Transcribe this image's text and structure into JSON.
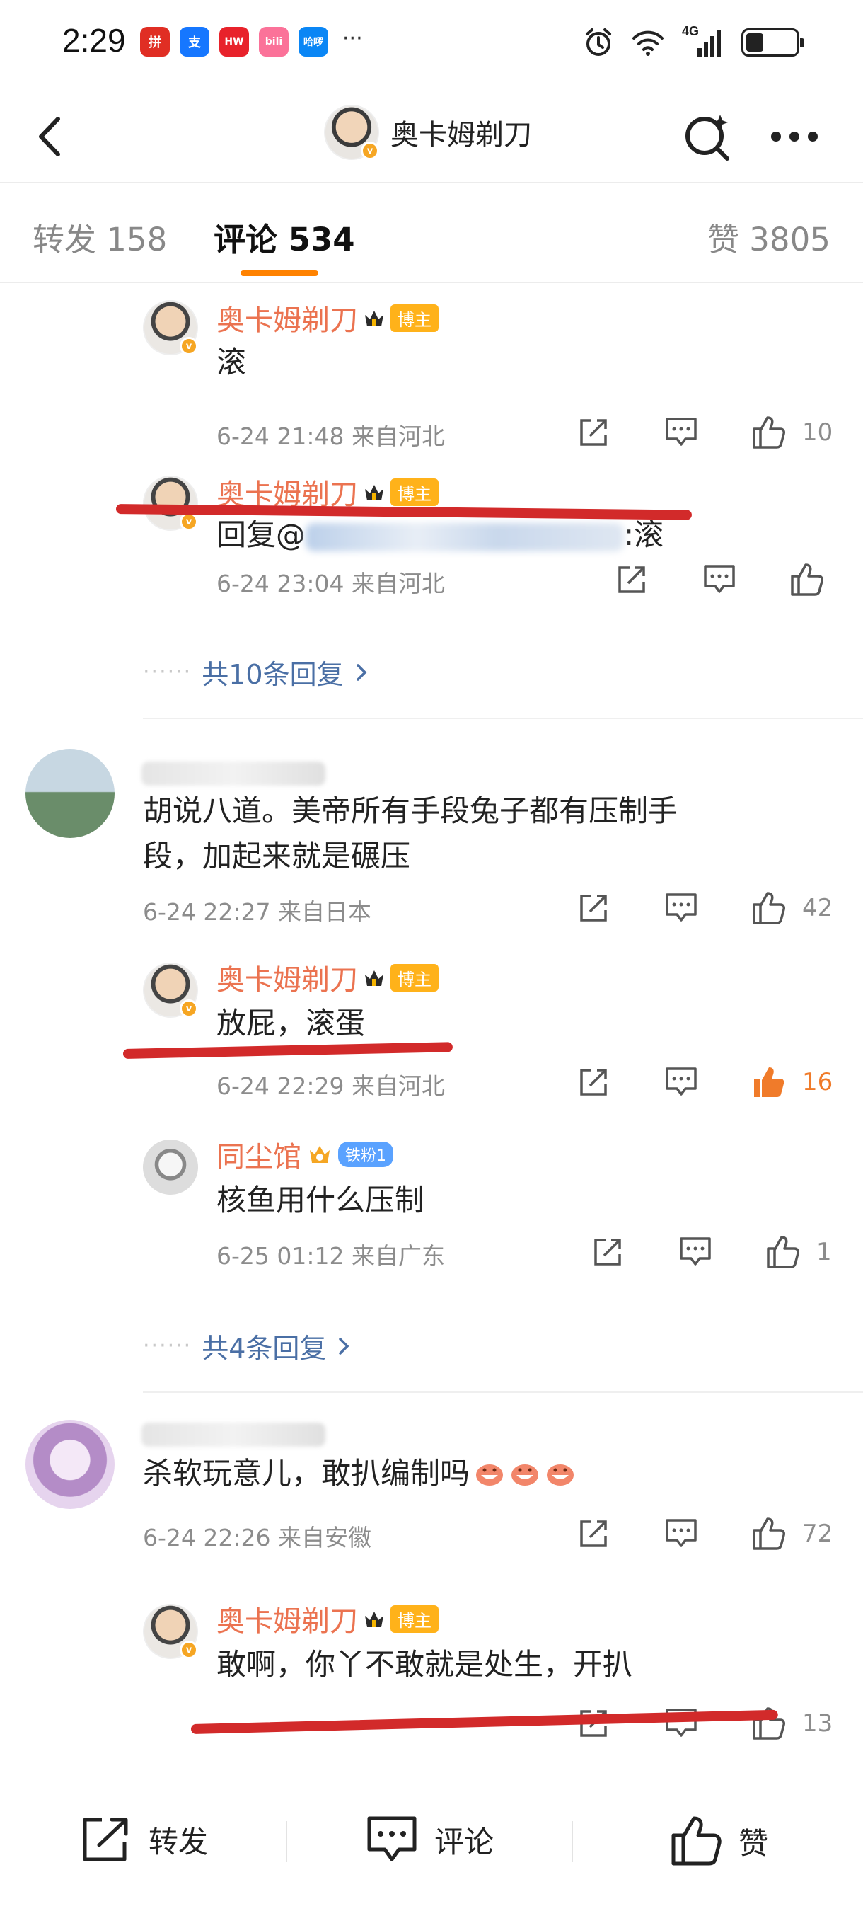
{
  "status_bar": {
    "time": "2:29",
    "apps": [
      {
        "name": "pinduoduo-app-icon",
        "label": "拼",
        "color": "#e02e24"
      },
      {
        "name": "alipay-app-icon",
        "label": "支",
        "color": "#1677ff"
      },
      {
        "name": "huawei-app-icon",
        "label": "HW",
        "color": "#e8222b"
      },
      {
        "name": "bilibili-app-icon",
        "label": "bili",
        "color": "#fb7299"
      },
      {
        "name": "hellobike-app-icon",
        "label": "哈啰",
        "color": "#0a86f5"
      }
    ],
    "more": "···",
    "network": "4G"
  },
  "nav": {
    "title": "奥卡姆剃刀"
  },
  "tabs": {
    "repost": "转发 158",
    "comment": "评论 534",
    "like": "赞 3805"
  },
  "labels": {
    "host_badge": "博主",
    "fan_badge": "铁粉1"
  },
  "comments": [
    {
      "name": "奥卡姆剃刀",
      "text": "滚",
      "meta": "6-24 21:48  来自河北",
      "likes": "10"
    },
    {
      "name": "奥卡姆剃刀",
      "text_prefix": "回复@",
      "text_suffix": ":滚",
      "meta": "6-24 23:04  来自河北",
      "likes": ""
    },
    {
      "more_replies": "共10条回复"
    },
    {
      "text_line1": "胡说八道。美帝所有手段兔子都有压制手",
      "text_line2": "段，加起来就是碾压",
      "meta": "6-24 22:27  来自日本",
      "likes": "42"
    },
    {
      "name": "奥卡姆剃刀",
      "text": "放屁，滚蛋",
      "meta": "6-24 22:29  来自河北",
      "likes": "16"
    },
    {
      "name": "同尘馆",
      "text": "核鱼用什么压制",
      "meta": "6-25 01:12  来自广东",
      "likes": "1"
    },
    {
      "more_replies": "共4条回复"
    },
    {
      "text": "杀软玩意儿，敢扒编制吗",
      "meta": "6-24 22:26  来自安徽",
      "likes": "72"
    },
    {
      "name": "奥卡姆剃刀",
      "text": "敢啊，你丫不敢就是处生，开扒",
      "likes": "13"
    }
  ],
  "bottom_bar": {
    "repost": "转发",
    "comment": "评论",
    "like": "赞"
  },
  "colors": {
    "accent": "#ff8200",
    "username": "#eb7350",
    "link": "#4a6fa5",
    "liked": "#f07b2a",
    "annotation_red": "#d22a2a"
  }
}
